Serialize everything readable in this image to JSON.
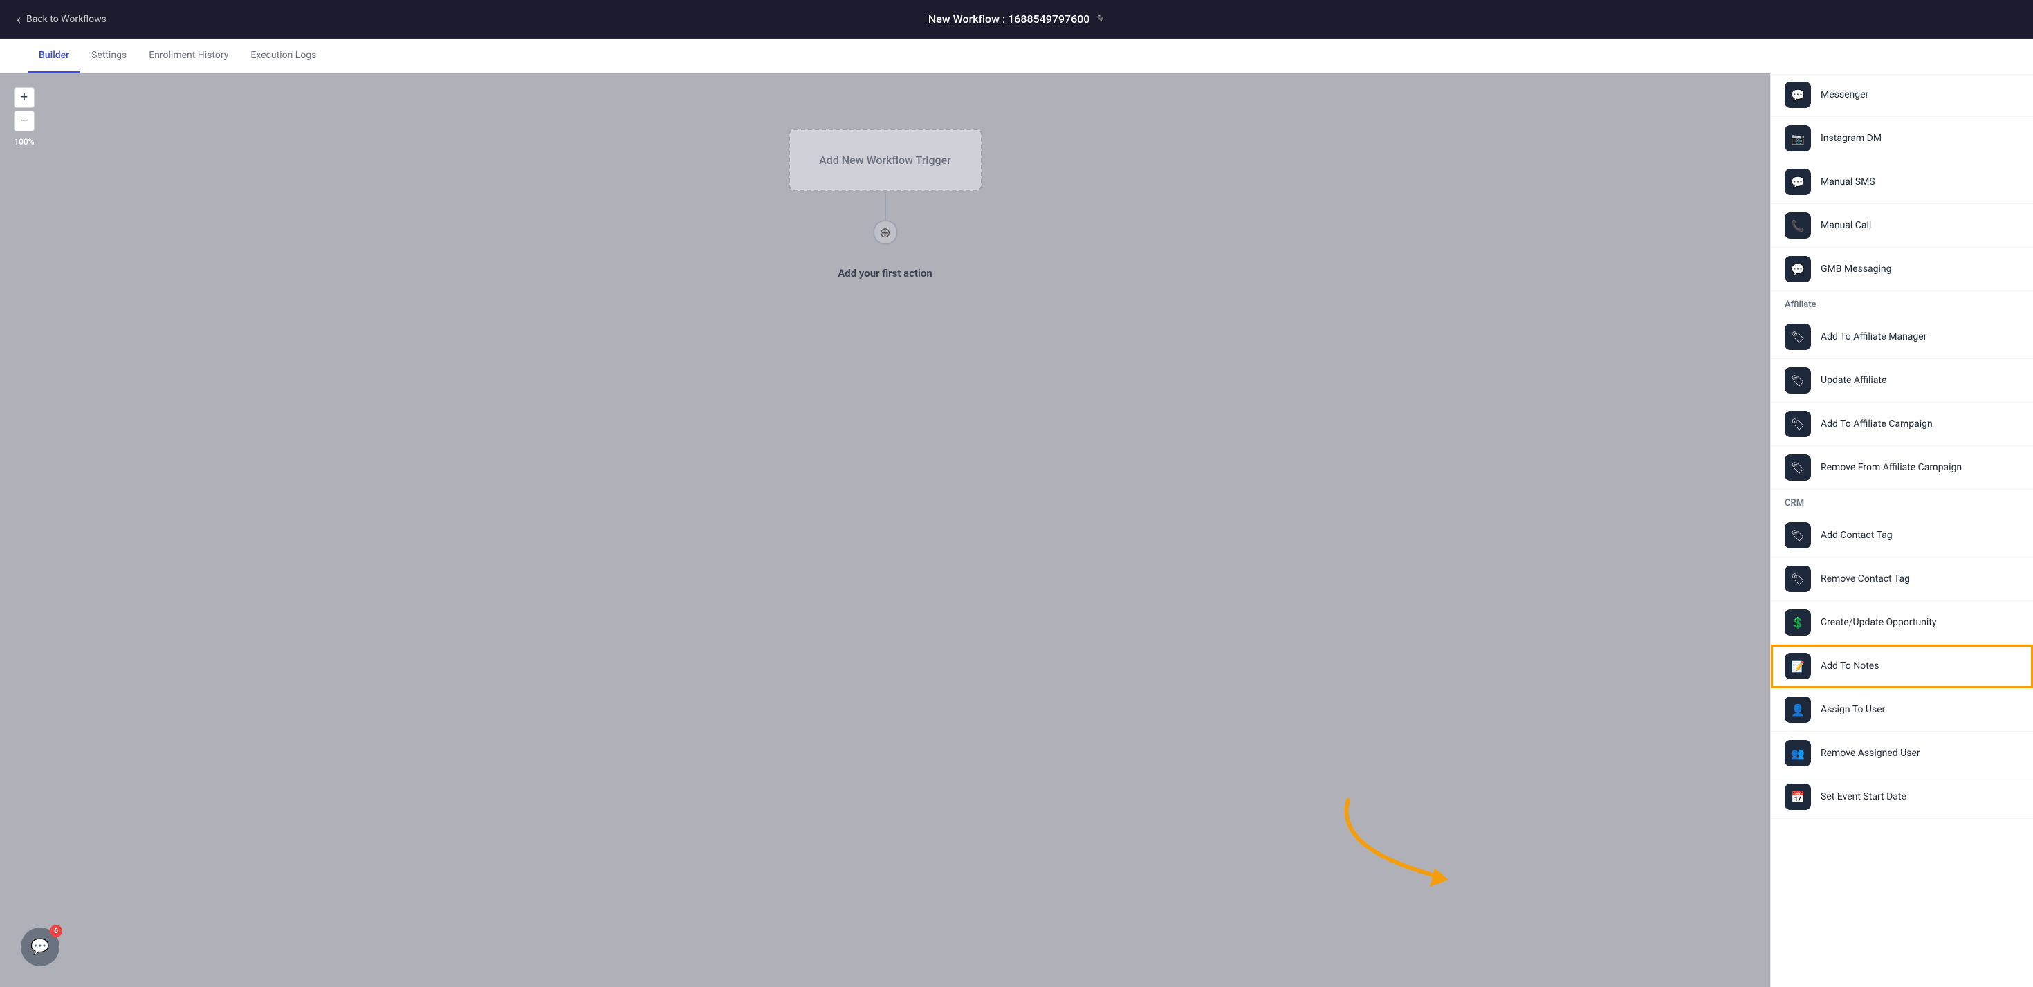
{
  "topbar": {
    "back_label": "Back to Workflows",
    "title": "New Workflow : 1688549797600",
    "edit_icon": "✎"
  },
  "tabs": [
    {
      "id": "builder",
      "label": "Builder",
      "active": true
    },
    {
      "id": "settings",
      "label": "Settings",
      "active": false
    },
    {
      "id": "enrollment",
      "label": "Enrollment History",
      "active": false
    },
    {
      "id": "execution",
      "label": "Execution Logs",
      "active": false
    }
  ],
  "canvas": {
    "zoom_in_label": "+",
    "zoom_out_label": "−",
    "zoom_percent": "100%",
    "trigger_node_text": "Add New Workflow Trigger",
    "add_action_label": "Add your first action",
    "add_icon": "⊕"
  },
  "chat_widget": {
    "badge_count": "6"
  },
  "sidebar": {
    "sections": [
      {
        "id": "messaging",
        "header": null,
        "items": [
          {
            "id": "messenger",
            "label": "Messenger",
            "icon": "💬"
          },
          {
            "id": "instagram-dm",
            "label": "Instagram DM",
            "icon": "📷"
          },
          {
            "id": "manual-sms",
            "label": "Manual SMS",
            "icon": "💬"
          },
          {
            "id": "manual-call",
            "label": "Manual Call",
            "icon": "📞"
          },
          {
            "id": "gmb-messaging",
            "label": "GMB Messaging",
            "icon": "💬"
          }
        ]
      },
      {
        "id": "affiliate",
        "header": "Affiliate",
        "items": [
          {
            "id": "add-affiliate-manager",
            "label": "Add To Affiliate Manager",
            "icon": "🏷"
          },
          {
            "id": "update-affiliate",
            "label": "Update Affiliate",
            "icon": "🏷"
          },
          {
            "id": "add-affiliate-campaign",
            "label": "Add To Affiliate Campaign",
            "icon": "🏷"
          },
          {
            "id": "remove-affiliate-campaign",
            "label": "Remove From Affiliate Campaign",
            "icon": "🏷"
          }
        ]
      },
      {
        "id": "crm",
        "header": "CRM",
        "items": [
          {
            "id": "add-contact-tag",
            "label": "Add Contact Tag",
            "icon": "🏷"
          },
          {
            "id": "remove-contact-tag",
            "label": "Remove Contact Tag",
            "icon": "🏷"
          },
          {
            "id": "create-update-opportunity",
            "label": "Create/Update Opportunity",
            "icon": "💲"
          },
          {
            "id": "add-to-notes",
            "label": "Add To Notes",
            "icon": "📝",
            "highlighted": true
          },
          {
            "id": "assign-to-user",
            "label": "Assign To User",
            "icon": "👤"
          },
          {
            "id": "remove-assigned-user",
            "label": "Remove Assigned User",
            "icon": "👥"
          },
          {
            "id": "set-event-start-date",
            "label": "Set Event Start Date",
            "icon": "📅"
          }
        ]
      }
    ]
  }
}
